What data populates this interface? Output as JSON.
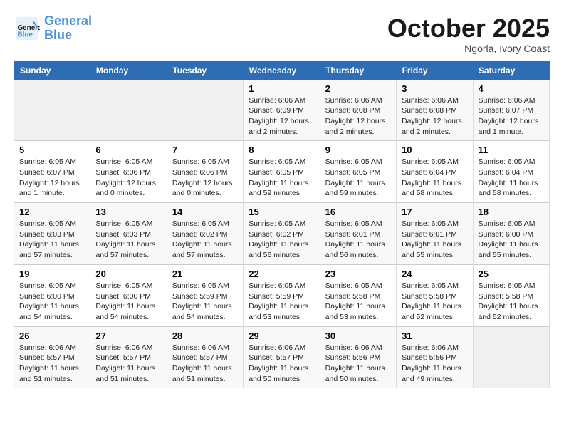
{
  "header": {
    "logo_line1": "General",
    "logo_line2": "Blue",
    "month": "October 2025",
    "location": "Ngorla, Ivory Coast"
  },
  "days_of_week": [
    "Sunday",
    "Monday",
    "Tuesday",
    "Wednesday",
    "Thursday",
    "Friday",
    "Saturday"
  ],
  "weeks": [
    [
      {
        "day": "",
        "info": ""
      },
      {
        "day": "",
        "info": ""
      },
      {
        "day": "",
        "info": ""
      },
      {
        "day": "1",
        "info": "Sunrise: 6:06 AM\nSunset: 6:09 PM\nDaylight: 12 hours\nand 2 minutes."
      },
      {
        "day": "2",
        "info": "Sunrise: 6:06 AM\nSunset: 6:08 PM\nDaylight: 12 hours\nand 2 minutes."
      },
      {
        "day": "3",
        "info": "Sunrise: 6:06 AM\nSunset: 6:08 PM\nDaylight: 12 hours\nand 2 minutes."
      },
      {
        "day": "4",
        "info": "Sunrise: 6:06 AM\nSunset: 6:07 PM\nDaylight: 12 hours\nand 1 minute."
      }
    ],
    [
      {
        "day": "5",
        "info": "Sunrise: 6:05 AM\nSunset: 6:07 PM\nDaylight: 12 hours\nand 1 minute."
      },
      {
        "day": "6",
        "info": "Sunrise: 6:05 AM\nSunset: 6:06 PM\nDaylight: 12 hours\nand 0 minutes."
      },
      {
        "day": "7",
        "info": "Sunrise: 6:05 AM\nSunset: 6:06 PM\nDaylight: 12 hours\nand 0 minutes."
      },
      {
        "day": "8",
        "info": "Sunrise: 6:05 AM\nSunset: 6:05 PM\nDaylight: 11 hours\nand 59 minutes."
      },
      {
        "day": "9",
        "info": "Sunrise: 6:05 AM\nSunset: 6:05 PM\nDaylight: 11 hours\nand 59 minutes."
      },
      {
        "day": "10",
        "info": "Sunrise: 6:05 AM\nSunset: 6:04 PM\nDaylight: 11 hours\nand 58 minutes."
      },
      {
        "day": "11",
        "info": "Sunrise: 6:05 AM\nSunset: 6:04 PM\nDaylight: 11 hours\nand 58 minutes."
      }
    ],
    [
      {
        "day": "12",
        "info": "Sunrise: 6:05 AM\nSunset: 6:03 PM\nDaylight: 11 hours\nand 57 minutes."
      },
      {
        "day": "13",
        "info": "Sunrise: 6:05 AM\nSunset: 6:03 PM\nDaylight: 11 hours\nand 57 minutes."
      },
      {
        "day": "14",
        "info": "Sunrise: 6:05 AM\nSunset: 6:02 PM\nDaylight: 11 hours\nand 57 minutes."
      },
      {
        "day": "15",
        "info": "Sunrise: 6:05 AM\nSunset: 6:02 PM\nDaylight: 11 hours\nand 56 minutes."
      },
      {
        "day": "16",
        "info": "Sunrise: 6:05 AM\nSunset: 6:01 PM\nDaylight: 11 hours\nand 56 minutes."
      },
      {
        "day": "17",
        "info": "Sunrise: 6:05 AM\nSunset: 6:01 PM\nDaylight: 11 hours\nand 55 minutes."
      },
      {
        "day": "18",
        "info": "Sunrise: 6:05 AM\nSunset: 6:00 PM\nDaylight: 11 hours\nand 55 minutes."
      }
    ],
    [
      {
        "day": "19",
        "info": "Sunrise: 6:05 AM\nSunset: 6:00 PM\nDaylight: 11 hours\nand 54 minutes."
      },
      {
        "day": "20",
        "info": "Sunrise: 6:05 AM\nSunset: 6:00 PM\nDaylight: 11 hours\nand 54 minutes."
      },
      {
        "day": "21",
        "info": "Sunrise: 6:05 AM\nSunset: 5:59 PM\nDaylight: 11 hours\nand 54 minutes."
      },
      {
        "day": "22",
        "info": "Sunrise: 6:05 AM\nSunset: 5:59 PM\nDaylight: 11 hours\nand 53 minutes."
      },
      {
        "day": "23",
        "info": "Sunrise: 6:05 AM\nSunset: 5:58 PM\nDaylight: 11 hours\nand 53 minutes."
      },
      {
        "day": "24",
        "info": "Sunrise: 6:05 AM\nSunset: 5:58 PM\nDaylight: 11 hours\nand 52 minutes."
      },
      {
        "day": "25",
        "info": "Sunrise: 6:05 AM\nSunset: 5:58 PM\nDaylight: 11 hours\nand 52 minutes."
      }
    ],
    [
      {
        "day": "26",
        "info": "Sunrise: 6:06 AM\nSunset: 5:57 PM\nDaylight: 11 hours\nand 51 minutes."
      },
      {
        "day": "27",
        "info": "Sunrise: 6:06 AM\nSunset: 5:57 PM\nDaylight: 11 hours\nand 51 minutes."
      },
      {
        "day": "28",
        "info": "Sunrise: 6:06 AM\nSunset: 5:57 PM\nDaylight: 11 hours\nand 51 minutes."
      },
      {
        "day": "29",
        "info": "Sunrise: 6:06 AM\nSunset: 5:57 PM\nDaylight: 11 hours\nand 50 minutes."
      },
      {
        "day": "30",
        "info": "Sunrise: 6:06 AM\nSunset: 5:56 PM\nDaylight: 11 hours\nand 50 minutes."
      },
      {
        "day": "31",
        "info": "Sunrise: 6:06 AM\nSunset: 5:56 PM\nDaylight: 11 hours\nand 49 minutes."
      },
      {
        "day": "",
        "info": ""
      }
    ]
  ]
}
